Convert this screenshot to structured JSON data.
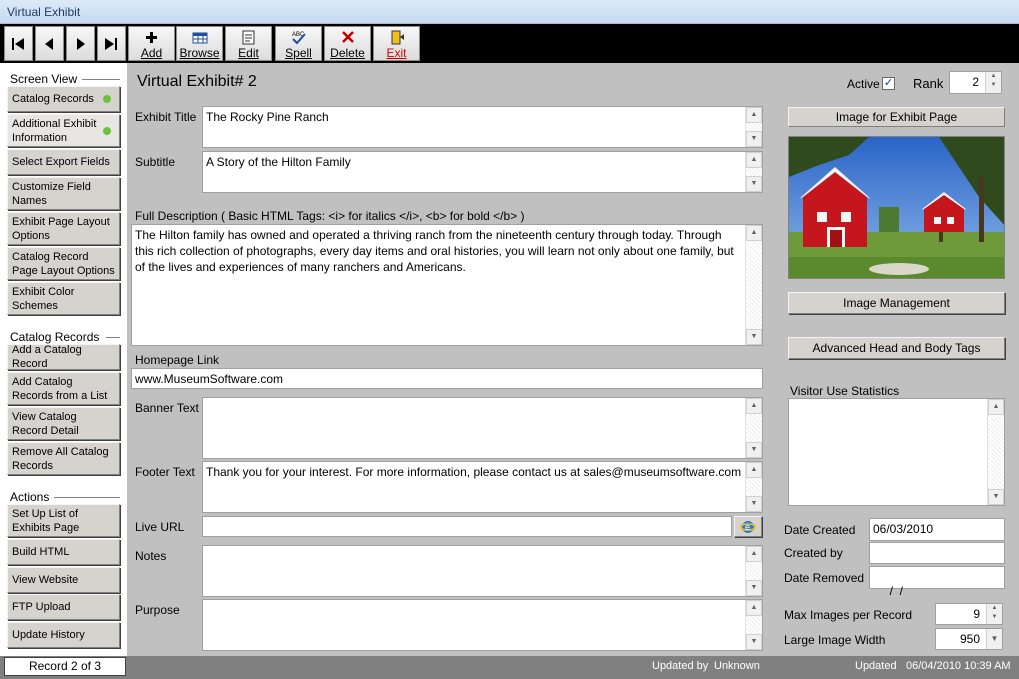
{
  "window": {
    "title": "Virtual Exhibit"
  },
  "toolbar": {
    "nav": [
      {
        "name": "first-record-button"
      },
      {
        "name": "previous-record-button"
      },
      {
        "name": "next-record-button"
      },
      {
        "name": "last-record-button"
      }
    ],
    "add_label": "Add",
    "browse_label": "Browse",
    "edit_label": "Edit",
    "spell_label": "Spell",
    "delete_label": "Delete",
    "exit_label": "Exit"
  },
  "sidebar": {
    "screen_view_heading": "Screen View",
    "screen_view": [
      {
        "label": "Catalog Records",
        "dot": true
      },
      {
        "label": "Additional Exhibit Information",
        "dot": true
      },
      {
        "label": "Select Export Fields",
        "dot": false
      },
      {
        "label": "Customize Field Names",
        "dot": false
      },
      {
        "label": "Exhibit Page Layout Options",
        "dot": false
      },
      {
        "label": "Catalog Record Page Layout Options",
        "dot": false
      },
      {
        "label": "Exhibit Color Schemes",
        "dot": false
      }
    ],
    "catalog_heading": "Catalog Records",
    "catalog": [
      {
        "label": "Add a Catalog Record"
      },
      {
        "label": "Add Catalog Records from a List"
      },
      {
        "label": "View Catalog Record Detail"
      },
      {
        "label": "Remove All Catalog Records"
      }
    ],
    "actions_heading": "Actions",
    "actions": [
      {
        "label": "Set Up List of Exhibits Page"
      },
      {
        "label": "Build HTML"
      },
      {
        "label": "View Website"
      },
      {
        "label": "FTP Upload"
      },
      {
        "label": "Update History"
      }
    ]
  },
  "record": {
    "heading": "Virtual Exhibit# 2",
    "active_label": "Active",
    "active_checked": true,
    "rank_label": "Rank",
    "rank_value": "2",
    "exhibit_title_label": "Exhibit Title",
    "exhibit_title": "The Rocky Pine Ranch",
    "subtitle_label": "Subtitle",
    "subtitle": "A Story of the Hilton Family",
    "full_description_label": "Full Description ( Basic HTML Tags: <i> for italics </i>, <b> for bold </b> )",
    "full_description": "The Hilton family has owned and operated a thriving ranch from the nineteenth century through today. Through this rich collection of photographs, every day items and oral histories, you will learn not only about one family, but of the lives and experiences of many ranchers and Americans.",
    "homepage_link_label": "Homepage Link",
    "homepage_link": "www.MuseumSoftware.com",
    "banner_text_label": "Banner Text",
    "banner_text": "",
    "footer_text_label": "Footer Text",
    "footer_text": "Thank you for your interest. For more information, please contact us at sales@museumsoftware.com",
    "live_url_label": "Live URL",
    "live_url": "",
    "notes_label": "Notes",
    "notes": "",
    "purpose_label": "Purpose",
    "purpose": ""
  },
  "right_panel": {
    "image_heading": "Image for Exhibit Page",
    "image_management_label": "Image Management",
    "advanced_tags_label": "Advanced Head and Body Tags",
    "visitor_stats_label": "Visitor Use Statistics",
    "date_created_label": "Date Created",
    "date_created": "06/03/2010",
    "created_by_label": "Created by",
    "created_by": "",
    "date_removed_label": "Date Removed",
    "date_removed": " /  /",
    "max_images_label": "Max Images per Record",
    "max_images": "9",
    "large_image_width_label": "Large Image Width",
    "large_image_width": "950"
  },
  "status": {
    "record_position": "Record 2 of 3",
    "updated_by_label": "Updated by",
    "updated_by": "Unknown",
    "updated_label": "Updated",
    "updated_timestamp": "06/04/2010 10:39 AM"
  },
  "colors": {
    "toolbar_bg": "#000000",
    "panel_bg": "#c0c0c0",
    "status_bg": "#808080",
    "dot": "#6cc23f",
    "exit_label": "#d40000"
  }
}
